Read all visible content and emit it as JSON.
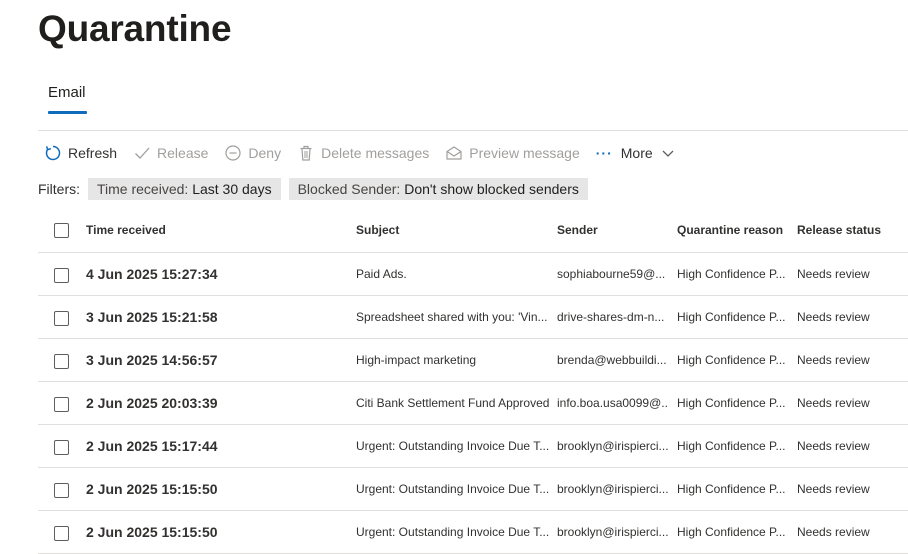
{
  "page": {
    "title": "Quarantine"
  },
  "tabs": [
    {
      "label": "Email",
      "selected": true
    }
  ],
  "toolbar": {
    "refresh": "Refresh",
    "release": "Release",
    "deny": "Deny",
    "delete": "Delete messages",
    "preview": "Preview message",
    "more": "More"
  },
  "filters": {
    "label": "Filters:",
    "items": [
      {
        "key": "Time received:",
        "value": "Last 30 days"
      },
      {
        "key": "Blocked Sender:",
        "value": "Don't show blocked senders"
      }
    ]
  },
  "table": {
    "columns": [
      "Time received",
      "Subject",
      "Sender",
      "Quarantine reason",
      "Release status"
    ],
    "rows": [
      {
        "time": "4 Jun 2025 15:27:34",
        "subject": "Paid Ads.",
        "sender": "sophiabourne59@...",
        "reason": "High Confidence P...",
        "status": "Needs review"
      },
      {
        "time": "3 Jun 2025 15:21:58",
        "subject": "Spreadsheet shared with you: 'Vin...",
        "sender": "drive-shares-dm-n...",
        "reason": "High Confidence P...",
        "status": "Needs review"
      },
      {
        "time": "3 Jun 2025 14:56:57",
        "subject": "High-impact marketing",
        "sender": "brenda@webbuildi...",
        "reason": "High Confidence P...",
        "status": "Needs review"
      },
      {
        "time": "2 Jun 2025 20:03:39",
        "subject": "Citi Bank Settlement Fund Approved",
        "sender": "info.boa.usa0099@...",
        "reason": "High Confidence P...",
        "status": "Needs review"
      },
      {
        "time": "2 Jun 2025 15:17:44",
        "subject": "Urgent: Outstanding Invoice Due T...",
        "sender": "brooklyn@irispierci...",
        "reason": "High Confidence P...",
        "status": "Needs review"
      },
      {
        "time": "2 Jun 2025 15:15:50",
        "subject": "Urgent: Outstanding Invoice Due T...",
        "sender": "brooklyn@irispierci...",
        "reason": "High Confidence P...",
        "status": "Needs review"
      },
      {
        "time": "2 Jun 2025 15:15:50",
        "subject": "Urgent: Outstanding Invoice Due T...",
        "sender": "brooklyn@irispierci...",
        "reason": "High Confidence P...",
        "status": "Needs review"
      }
    ]
  }
}
